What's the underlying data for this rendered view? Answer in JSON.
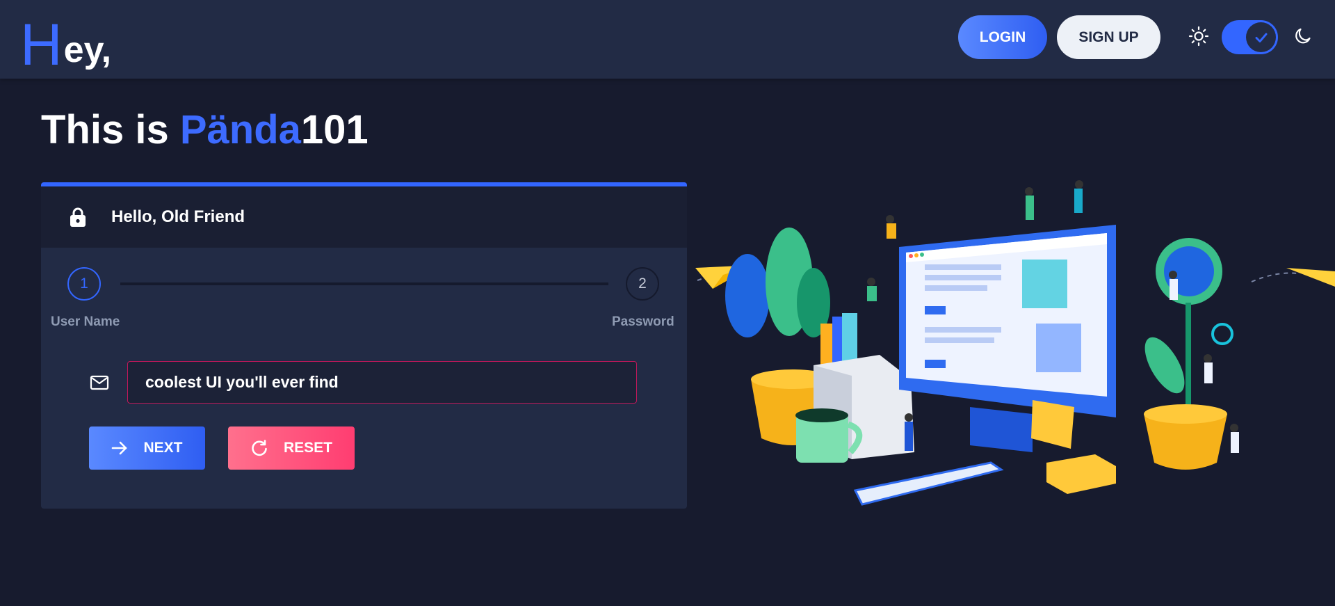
{
  "header": {
    "logo_initial": "H",
    "logo_rest": "ey,",
    "login_label": "LOGIN",
    "signup_label": "SIGN UP",
    "theme_toggle_on": true
  },
  "title": {
    "prefix": "This is ",
    "brand": "Pända",
    "suffix": "101"
  },
  "card": {
    "title": "Hello, Old Friend",
    "steps": [
      {
        "number": "1",
        "label": "User Name"
      },
      {
        "number": "2",
        "label": "Password"
      }
    ],
    "input_value": "coolest UI you'll ever find",
    "next_label": "NEXT",
    "reset_label": "RESET"
  },
  "colors": {
    "accent": "#3366ff",
    "background": "#171b2e",
    "header_bg": "#222b45",
    "danger": "#ff3d71",
    "input_border": "#c2185b"
  },
  "icons": [
    "sun-icon",
    "check-icon",
    "moon-icon",
    "lock-icon",
    "mail-icon",
    "arrow-right-icon",
    "refresh-icon"
  ]
}
